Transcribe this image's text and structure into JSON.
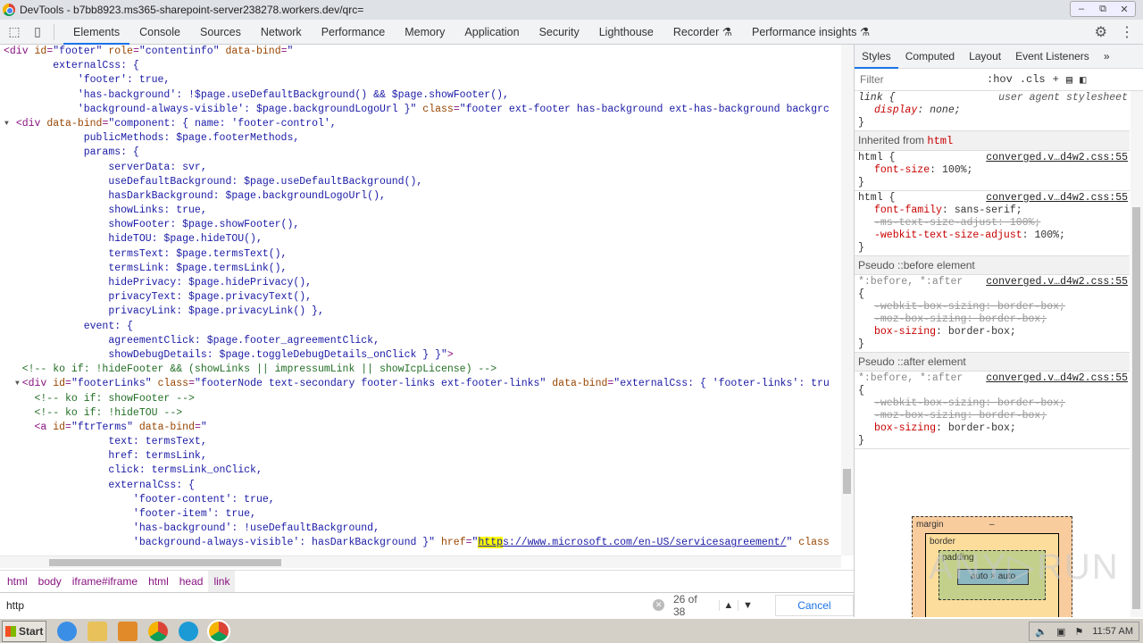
{
  "window": {
    "title": "DevTools - b7bb8923.ms365-sharepoint-server238278.workers.dev/qrc=",
    "controls": [
      "–",
      "⧉",
      "✕"
    ]
  },
  "tabs": [
    "Elements",
    "Console",
    "Sources",
    "Network",
    "Performance",
    "Memory",
    "Application",
    "Security",
    "Lighthouse",
    "Recorder ⚗",
    "Performance insights ⚗"
  ],
  "code_lines": [
    [
      [
        "t",
        "<div "
      ],
      [
        "n",
        "id"
      ],
      [
        "t",
        "="
      ],
      [
        "v",
        "\"footer\""
      ],
      [
        "n",
        " role"
      ],
      [
        "t",
        "="
      ],
      [
        "v",
        "\"contentinfo\""
      ],
      [
        "n",
        " data-bind"
      ],
      [
        "t",
        "="
      ],
      [
        "v",
        "\""
      ]
    ],
    [
      [
        "v",
        "        externalCss: {"
      ]
    ],
    [
      [
        "v",
        "            'footer': true,"
      ]
    ],
    [
      [
        "v",
        "            'has-background': !$page.useDefaultBackground() && $page.showFooter(),"
      ]
    ],
    [
      [
        "v",
        "            'background-always-visible': $page.backgroundLogoUrl }\""
      ],
      [
        "n",
        " class"
      ],
      [
        "t",
        "="
      ],
      [
        "v",
        "\"footer ext-footer has-background ext-has-background backgrc"
      ]
    ],
    [
      [
        "p",
        "  "
      ],
      [
        "t",
        "<div "
      ],
      [
        "n",
        "data-bind"
      ],
      [
        "t",
        "="
      ],
      [
        "v",
        "\"component: { name: 'footer-control',"
      ]
    ],
    [
      [
        "v",
        "             publicMethods: $page.footerMethods,"
      ]
    ],
    [
      [
        "v",
        "             params: {"
      ]
    ],
    [
      [
        "v",
        "                 serverData: svr,"
      ]
    ],
    [
      [
        "v",
        "                 useDefaultBackground: $page.useDefaultBackground(),"
      ]
    ],
    [
      [
        "v",
        "                 hasDarkBackground: $page.backgroundLogoUrl(),"
      ]
    ],
    [
      [
        "v",
        "                 showLinks: true,"
      ]
    ],
    [
      [
        "v",
        "                 showFooter: $page.showFooter(),"
      ]
    ],
    [
      [
        "v",
        "                 hideTOU: $page.hideTOU(),"
      ]
    ],
    [
      [
        "v",
        "                 termsText: $page.termsText(),"
      ]
    ],
    [
      [
        "v",
        "                 termsLink: $page.termsLink(),"
      ]
    ],
    [
      [
        "v",
        "                 hidePrivacy: $page.hidePrivacy(),"
      ]
    ],
    [
      [
        "v",
        "                 privacyText: $page.privacyText(),"
      ]
    ],
    [
      [
        "v",
        "                 privacyLink: $page.privacyLink() },"
      ]
    ],
    [
      [
        "v",
        "             event: {"
      ]
    ],
    [
      [
        "v",
        "                 agreementClick: $page.footer_agreementClick,"
      ]
    ],
    [
      [
        "v",
        "                 showDebugDetails: $page.toggleDebugDetails_onClick } }\""
      ],
      [
        "t",
        ">"
      ]
    ],
    [
      [
        "c",
        "   <!-- ko if: !hideFooter && (showLinks || impressumLink || showIcpLicense) -->"
      ]
    ],
    [
      [
        "p",
        "   "
      ],
      [
        "t",
        "<div "
      ],
      [
        "n",
        "id"
      ],
      [
        "t",
        "="
      ],
      [
        "v",
        "\"footerLinks\""
      ],
      [
        "n",
        " class"
      ],
      [
        "t",
        "="
      ],
      [
        "v",
        "\"footerNode text-secondary footer-links ext-footer-links\""
      ],
      [
        "n",
        " data-bind"
      ],
      [
        "t",
        "="
      ],
      [
        "v",
        "\"externalCss: { 'footer-links': tru"
      ]
    ],
    [
      [
        "c",
        "     <!-- ko if: showFooter -->"
      ]
    ],
    [
      [
        "c",
        "     <!-- ko if: !hideTOU -->"
      ]
    ],
    [
      [
        "p",
        "     "
      ],
      [
        "t",
        "<a "
      ],
      [
        "n",
        "id"
      ],
      [
        "t",
        "="
      ],
      [
        "v",
        "\"ftrTerms\""
      ],
      [
        "n",
        " data-bind"
      ],
      [
        "t",
        "="
      ],
      [
        "v",
        "\""
      ]
    ],
    [
      [
        "v",
        "                 text: termsText,"
      ]
    ],
    [
      [
        "v",
        "                 href: termsLink,"
      ]
    ],
    [
      [
        "v",
        "                 click: termsLink_onClick,"
      ]
    ],
    [
      [
        "v",
        "                 externalCss: {"
      ]
    ],
    [
      [
        "v",
        "                     'footer-content': true,"
      ]
    ],
    [
      [
        "v",
        "                     'footer-item': true,"
      ]
    ],
    [
      [
        "v",
        "                     'has-background': !useDefaultBackground,"
      ]
    ],
    [
      [
        "v",
        "                     'background-always-visible': hasDarkBackground }\""
      ],
      [
        "n",
        " href"
      ],
      [
        "t",
        "="
      ],
      [
        "v",
        "\""
      ],
      [
        "h",
        "http"
      ],
      [
        "u",
        "s://www.microsoft.com/en-US/servicesagreement/"
      ],
      [
        "v",
        "\""
      ],
      [
        "n",
        " class"
      ]
    ]
  ],
  "breadcrumbs": [
    "html",
    "body",
    "iframe#iframe",
    "html",
    "head",
    "link"
  ],
  "search": {
    "value": "http",
    "count": "26 of 38",
    "cancel": "Cancel"
  },
  "styles": {
    "tabs": [
      "Styles",
      "Computed",
      "Layout",
      "Event Listeners",
      "»"
    ],
    "filter_placeholder": "Filter",
    "hov": ":hov",
    "cls": ".cls",
    "rule0": {
      "selector": "link {",
      "source": "user agent stylesheet",
      "prop": "display",
      "val": "none;"
    },
    "inherited_label": "Inherited from ",
    "inherited_tag": "html",
    "rule1": {
      "selector": "html {",
      "source": "converged.v…d4w2.css:55",
      "prop": "font-size",
      "val": "100%;"
    },
    "rule2": {
      "selector": "html {",
      "source": "converged.v…d4w2.css:55",
      "p1": "font-family",
      "v1": "sans-serif;",
      "p2": "-ms-text-size-adjust: 100%;",
      "p3": "-webkit-text-size-adjust",
      "v3": "100%;"
    },
    "before_label": "Pseudo ::before element",
    "after_label": "Pseudo ::after element",
    "pseudo": {
      "selector": "*:before, *:after",
      "source": "converged.v…d4w2.css:55",
      "open": "{",
      "s1": "-webkit-box-sizing: border-box;",
      "s2": "-moz-box-sizing: border-box;",
      "p": "box-sizing",
      "v": "border-box;",
      "close": "}"
    },
    "close": "}"
  },
  "boxmodel": {
    "margin": "margin",
    "border": "border",
    "padding": "padding",
    "content": "auto × auto",
    "dash": "–"
  },
  "watermark": "ANY▷RUN",
  "taskbar": {
    "start": "Start",
    "time": "11:57 AM"
  }
}
